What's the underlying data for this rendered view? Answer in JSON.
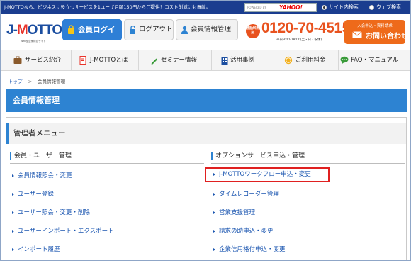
{
  "topbar": {
    "notice": "J-MOTTOなら、ビジネスに役立つサービスを1ユーザ月額150円からご提供！コスト削減にも貢献。",
    "search": {
      "powered_by": "POWERED BY",
      "engine": "YAHOO!"
    },
    "radio_site": "サイト内検索",
    "radio_web": "ウェブ検索",
    "selected": "サイト内検索"
  },
  "header": {
    "logo": {
      "brand_left": "J-",
      "brand_m": "M",
      "brand_right": "OTTO",
      "tag": "Web型企業総合サイト"
    },
    "login_label": "会員ログイン",
    "logout_label": "ログアウト",
    "member_label": "会員情報管理",
    "tel_badge": "通話料無料",
    "tel_number": "0120-70-4515",
    "tel_hours": "平日9:00-18:00(土・日・祝休)",
    "contact_sub": "入会申込・資料請求",
    "contact_main": "お問い合わせ"
  },
  "nav": {
    "items": [
      {
        "label": "サービス紹介",
        "icon": "briefcase-icon"
      },
      {
        "label": "J-MOTTOとは",
        "icon": "document-icon"
      },
      {
        "label": "セミナー情報",
        "icon": "pen-icon"
      },
      {
        "label": "活用事例",
        "icon": "building-icon"
      },
      {
        "label": "ご利用料金",
        "icon": "coin-icon"
      },
      {
        "label": "FAQ・マニュアル",
        "icon": "speech-bubble-icon"
      }
    ]
  },
  "breadcrumb": {
    "home": "トップ",
    "separator": ">",
    "current": "会員情報管理"
  },
  "page_title": "会員情報管理",
  "admin_menu": {
    "title": "管理者メニュー",
    "left": {
      "heading": "会員・ユーザー管理",
      "links": [
        "会員情報照会・変更",
        "ユーザー登録",
        "ユーザー照会・変更・削除",
        "ユーザーインポート・エクスポート",
        "インポート履歴"
      ]
    },
    "right": {
      "heading": "オプションサービス申込・管理",
      "links": [
        "J-MOTTOワークフロー申込・変更",
        "タイムレコーダー管理",
        "営業支援管理",
        "請求の助申込・変更",
        "企業信用格付申込・変更"
      ]
    }
  },
  "colors": {
    "navy": "#1a3d8f",
    "blue": "#2d83d2",
    "orange": "#e8521e",
    "highlight": "#e02020",
    "link": "#1a55b0"
  }
}
